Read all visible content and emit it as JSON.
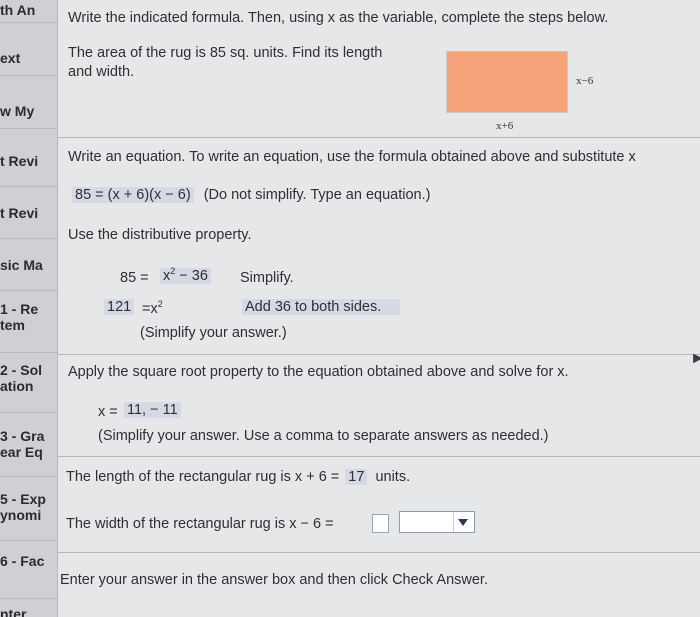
{
  "sidebar": {
    "items": [
      {
        "lines": [
          "th An"
        ]
      },
      {
        "lines": [
          "ext"
        ]
      },
      {
        "lines": [
          "w My"
        ]
      },
      {
        "lines": [
          "t Revi"
        ]
      },
      {
        "lines": [
          "t Revi"
        ]
      },
      {
        "lines": [
          "sic Ma"
        ]
      },
      {
        "lines": [
          "1 - Re",
          "tem"
        ]
      },
      {
        "lines": [
          "2 - Sol",
          "ation"
        ]
      },
      {
        "lines": [
          "3 - Gra",
          "ear Eq"
        ]
      },
      {
        "lines": [
          "5 - Exp",
          "ynomi"
        ]
      },
      {
        "lines": [
          "6 - Fac"
        ]
      },
      {
        "lines": [
          "nter"
        ]
      }
    ]
  },
  "problem": {
    "instruction": "Write the indicated formula. Then, using x as the variable, complete the steps below.",
    "statement_line1": "The area of the rug is 85 sq. units. Find its length",
    "statement_line2": "and width.",
    "rug_color": "#f6a27a",
    "rug_side_label": "x−6",
    "rug_bottom_label": "x+6"
  },
  "steps": {
    "write_equation_prompt": "Write an equation. To write an equation, use the formula obtained above and substitute x",
    "equation_answer": "85 = (x + 6)(x − 6)",
    "equation_note": "(Do not simplify. Type an equation.)",
    "distributive_prompt": "Use the distributive property.",
    "step1_lhs": "85 =",
    "step1_rhs_base": "x",
    "step1_rhs_exp": "2",
    "step1_rhs_rest": " − 36",
    "step1_note": "Simplify.",
    "step2_lhs": "121",
    "step2_rhs": "=x",
    "step2_exp": "2",
    "step2_note": "Add 36 to both sides.",
    "step2_hint": "(Simplify your answer.)",
    "sqrt_prompt": "Apply the square root property to the equation obtained above and solve for x.",
    "x_label": "x =",
    "x_answer": "11, − 11",
    "x_hint": "(Simplify your answer. Use a comma to separate answers as needed.)",
    "length_text": "The length of the rectangular rug is x + 6 =",
    "length_answer": "17",
    "length_unit": "units.",
    "width_text": "The width of the rectangular rug is x − 6 =",
    "footer": "Enter your answer in the answer box and then click Check Answer."
  }
}
